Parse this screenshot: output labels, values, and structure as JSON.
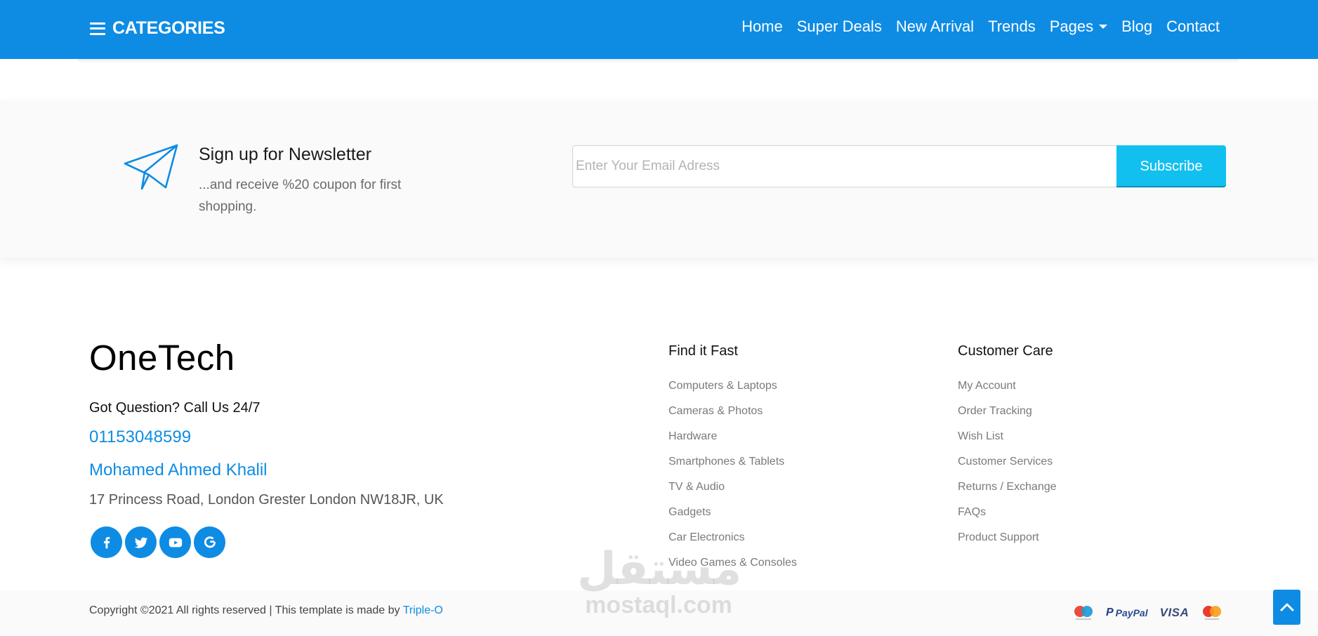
{
  "nav": {
    "categories_label": "CATEGORIES",
    "links": [
      "Home",
      "Super Deals",
      "New Arrival",
      "Trends",
      "Pages",
      "Blog",
      "Contact"
    ]
  },
  "newsletter": {
    "title": "Sign up for Newsletter",
    "subtitle": "...and receive %20 coupon for first shopping.",
    "placeholder": "Enter Your Email Adress",
    "button": "Subscribe"
  },
  "footer": {
    "brand": "OneTech",
    "question": "Got Question? Call Us 24/7",
    "phone": "01153048599",
    "name": "Mohamed Ahmed Khalil",
    "address": "17 Princess Road, London Grester London NW18JR, UK",
    "socials": [
      "facebook-icon",
      "twitter-icon",
      "youtube-icon",
      "google-icon"
    ],
    "columns": [
      {
        "title": "Find it Fast",
        "items": [
          "Computers & Laptops",
          "Cameras & Photos",
          "Hardware",
          "Smartphones & Tablets",
          "TV & Audio",
          "Gadgets",
          "Car Electronics",
          "Video Games & Consoles"
        ]
      },
      {
        "title": "Customer Care",
        "items": [
          "My Account",
          "Order Tracking",
          "Wish List",
          "Customer Services",
          "Returns / Exchange",
          "FAQs",
          "Product Support"
        ]
      }
    ]
  },
  "bottom": {
    "copyright": "Copyright ©2021 All rights reserved | This template is made by ",
    "author": "Triple-O",
    "payments": {
      "paypal_p": "P",
      "paypal": "PayPal",
      "visa": "VISA"
    }
  },
  "watermark": {
    "arabic": "مستقل",
    "latin": "mostaql.com"
  },
  "colors": {
    "primary": "#0e8ce4",
    "subscribe": "#12c0f0",
    "light_bg": "#fafafa"
  }
}
